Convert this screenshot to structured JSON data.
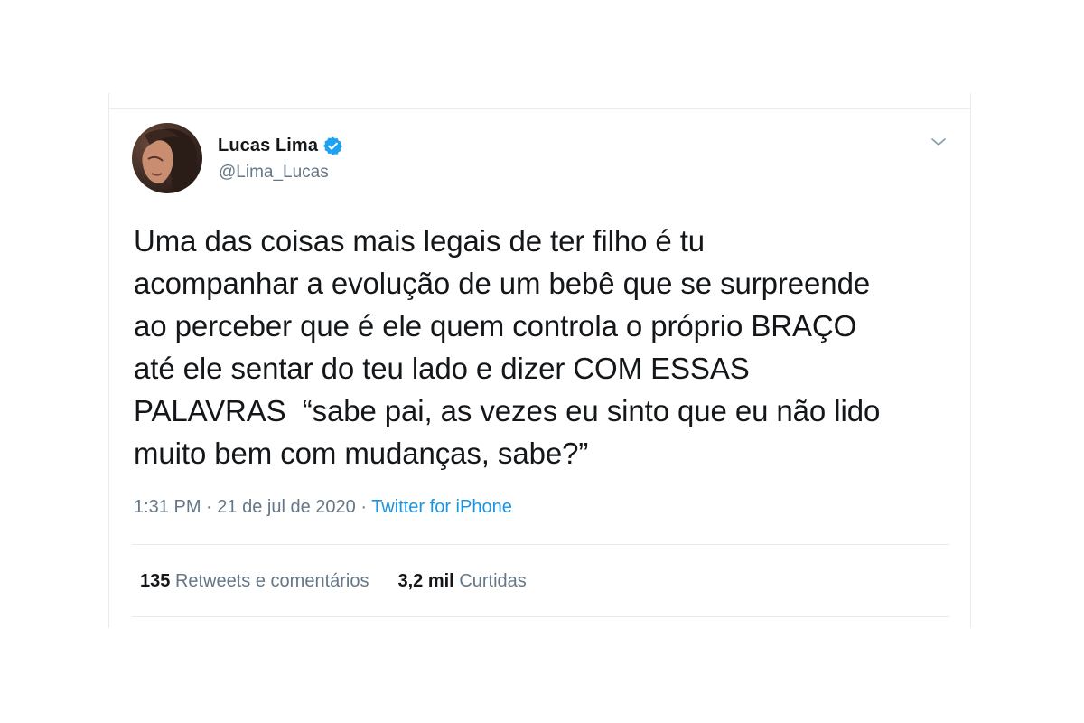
{
  "author": {
    "display_name": "Lucas Lima",
    "handle": "@Lima_Lucas",
    "verified": true,
    "avatar_icon": "profile-photo"
  },
  "menu": {
    "icon": "chevron-down-icon"
  },
  "tweet": {
    "text": "Uma das coisas mais legais de ter filho é tu\nacompanhar a evolução de um bebê que se surpreende\nao perceber que é ele quem controla o próprio BRAÇO\naté ele sentar do teu lado e dizer COM ESSAS\nPALAVRAS  “sabe pai, as vezes eu sinto que eu não lido\nmuito bem com mudanças, sabe?”",
    "time": "1:31 PM",
    "date": "21 de jul de 2020",
    "separator": "·",
    "source": "Twitter for iPhone"
  },
  "stats": {
    "retweets_count": "135",
    "retweets_label": "Retweets e comentários",
    "likes_count": "3,2 mil",
    "likes_label": "Curtidas"
  },
  "colors": {
    "text": "#14171a",
    "secondary": "#657786",
    "link": "#1b95e0",
    "verified": "#1da1f2",
    "border": "#e6ecf0"
  }
}
